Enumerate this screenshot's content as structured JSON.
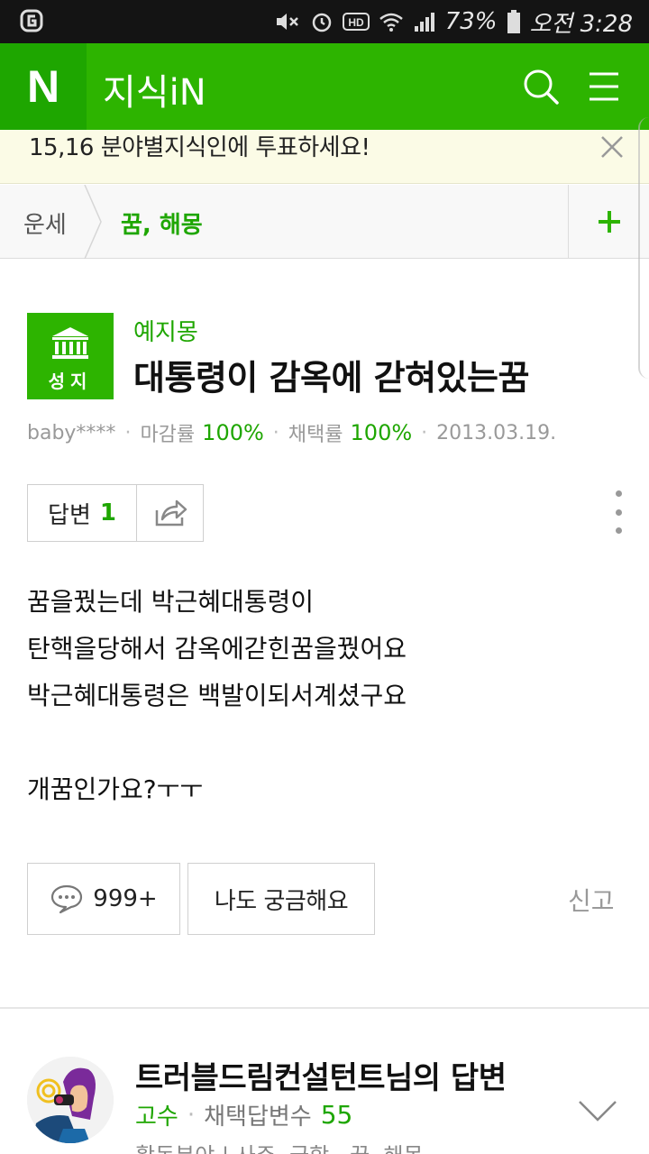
{
  "status_bar": {
    "battery": "73%",
    "time": "오전 3:28",
    "icons": [
      "g-app-icon",
      "mute-icon",
      "alarm-icon",
      "hd-icon",
      "wifi-icon",
      "signal-icon",
      "battery-icon"
    ]
  },
  "header": {
    "logo": "N",
    "title": "지식iN",
    "icons": [
      "search-icon",
      "menu-icon"
    ]
  },
  "banner": {
    "text": "15,16 분야별지식인에 투표하세요!"
  },
  "breadcrumb": {
    "parent": "운세",
    "current": "꿈, 해몽"
  },
  "question": {
    "badge_label": "성지",
    "asker": "예지몽",
    "title": "대통령이 감옥에 갇혀있는꿈",
    "author": "baby****",
    "closing_rate_label": "마감률",
    "closing_rate": "100%",
    "adoption_rate_label": "채택률",
    "adoption_rate": "100%",
    "date": "2013.03.19.",
    "answer_label": "답변",
    "answer_count": "1",
    "body": [
      "꿈을꿨는데 박근혜대통령이",
      "탄핵을당해서 감옥에갇힌꿈을꿨어요",
      "박근혜대통령은 백발이되서계셨구요",
      "",
      "개꿈인가요?ㅜㅜ"
    ],
    "comment_count": "999+",
    "curious_label": "나도 궁금해요",
    "report_label": "신고"
  },
  "answer": {
    "title": "트러블드림컨설턴트님의 답변",
    "rank": "고수",
    "adopted_label": "채택답변수",
    "adopted_count": "55",
    "fields": "활동분야 | 사주, 궁합 · 꿈, 해몽"
  },
  "colors": {
    "brand_green": "#2db400",
    "dark_green": "#1ea600",
    "status_bar": "#141414",
    "banner_bg": "#fbfbe6"
  }
}
